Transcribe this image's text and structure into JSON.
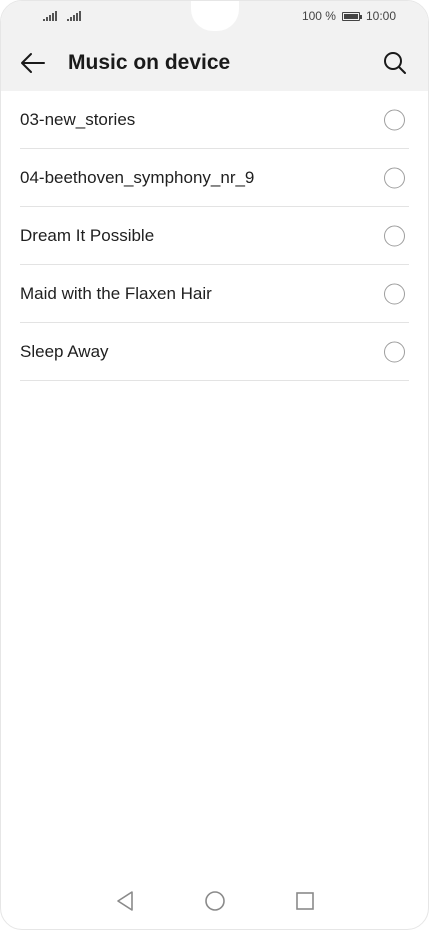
{
  "status_bar": {
    "battery_percent": "100 %",
    "battery_level": 1.0,
    "time": "10:00"
  },
  "app_bar": {
    "back_icon": "arrow-left-icon",
    "title": "Music on device",
    "search_icon": "search-icon"
  },
  "songs": [
    {
      "label": "03-new_stories",
      "selected": false
    },
    {
      "label": "04-beethoven_symphony_nr_9",
      "selected": false
    },
    {
      "label": "Dream It Possible",
      "selected": false
    },
    {
      "label": "Maid with the Flaxen Hair",
      "selected": false
    },
    {
      "label": "Sleep Away",
      "selected": false
    }
  ],
  "nav_bar": {
    "back_icon": "triangle-back-icon",
    "home_icon": "circle-home-icon",
    "recents_icon": "square-recents-icon"
  },
  "colors": {
    "header_bg": "#f2f2f2",
    "divider": "#e3e3e3",
    "radio_border": "#9e9e9e"
  }
}
